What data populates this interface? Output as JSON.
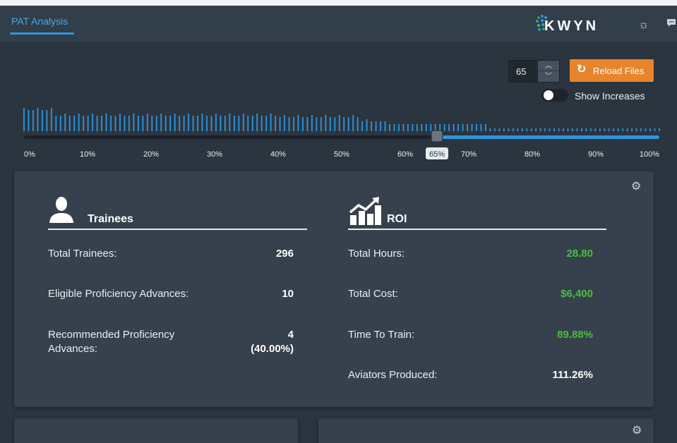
{
  "header": {
    "tab_label": "PAT Analysis",
    "logo_text": "KWYN",
    "icons": [
      "brightness-icon",
      "chat-icon"
    ]
  },
  "controls": {
    "threshold_value": "65",
    "reload_label": "Reload Files",
    "reload_icon": "refresh-icon",
    "show_increases_label": "Show Increases",
    "show_increases_on": false
  },
  "slider": {
    "value_label": "65%",
    "value_percent": 65,
    "tick_labels": [
      "0%",
      "10%",
      "20%",
      "30%",
      "40%",
      "50%",
      "60%",
      "70%",
      "80%",
      "90%",
      "100%"
    ]
  },
  "trainees": {
    "title": "Trainees",
    "icon": "person-icon",
    "total_label": "Total Trainees:",
    "total_value": "296",
    "eligible_label": "Eligible Proficiency Advances:",
    "eligible_value": "10",
    "recommended_label_1": "Recommended Proficiency",
    "recommended_label_2": "Advances:",
    "recommended_value_1": "4",
    "recommended_value_2": "(40.00%)"
  },
  "roi": {
    "title": "ROI",
    "icon": "growth-chart-icon",
    "hours_label": "Total Hours:",
    "hours_value": "28.80",
    "cost_label": "Total Cost:",
    "cost_value": "$6,400",
    "time_label": "Time To Train:",
    "time_value": "89.88%",
    "aviators_label": "Aviators Produced:",
    "aviators_value": "111.26%"
  },
  "colors": {
    "accent_blue": "#2f96dd",
    "accent_orange": "#e8842b",
    "value_green": "#4bbd3c",
    "background": "#2b3540",
    "card": "#36414d"
  }
}
